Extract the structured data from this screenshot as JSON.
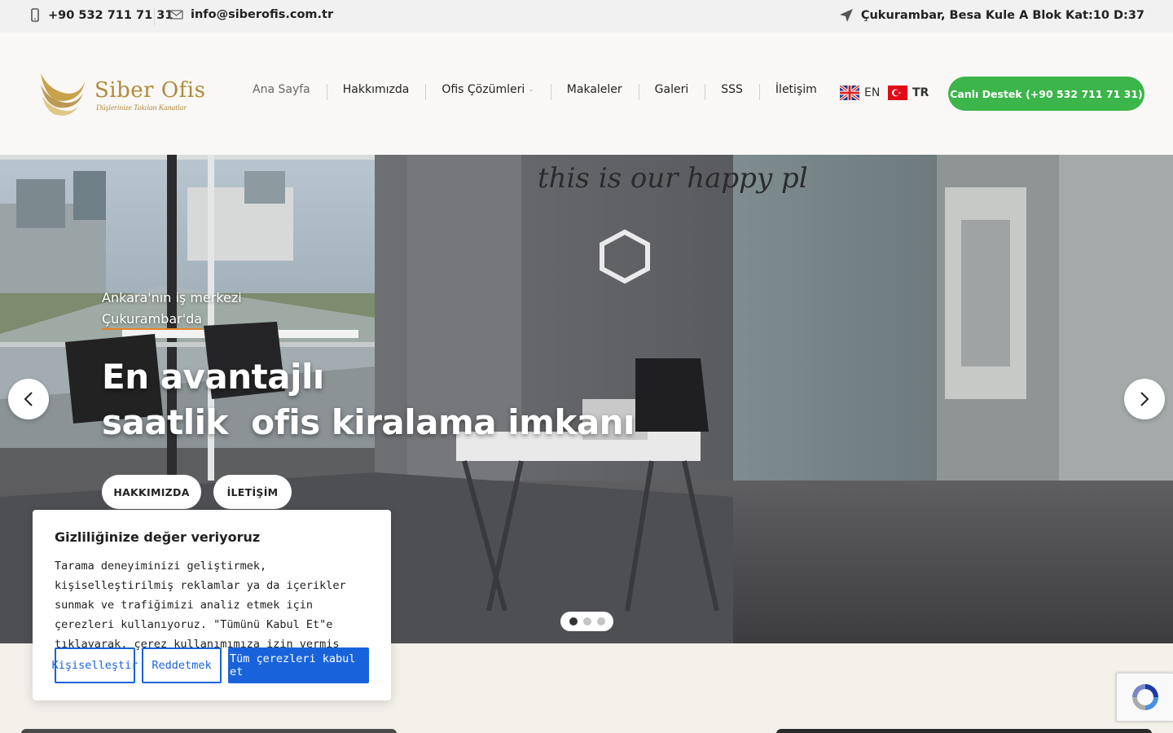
{
  "topbar": {
    "phone": "+90 532 711 71 31",
    "email": "info@siberofis.com.tr",
    "address": "Çukurambar, Besa Kule A Blok Kat:10 D:37"
  },
  "header": {
    "logo": {
      "title": "Siber Ofis",
      "tagline": "Düşlerinize Takılan Kanatlar"
    },
    "nav": [
      {
        "label": "Ana Sayfa"
      },
      {
        "label": "Hakkımızda"
      },
      {
        "label": "Ofis Çözümleri"
      },
      {
        "label": "Makaleler"
      },
      {
        "label": "Galeri"
      },
      {
        "label": "SSS"
      },
      {
        "label": "İletişim"
      }
    ],
    "languages": [
      {
        "code": "EN"
      },
      {
        "code": "TR"
      }
    ],
    "live_support": "Canlı Destek (+90 532 711 71 31)"
  },
  "hero": {
    "subtitle_line1": "Ankara'nın iş merkezi",
    "subtitle_line2": "Çukurambar'da",
    "title_line1": "En avantajlı",
    "title_line2": "saatlik  ofis kiralama imkanı",
    "button_about": "HAKKIMIZDA",
    "button_contact": "İLETİŞİM",
    "wall_text": "this is our happy pl",
    "slide_count": 3,
    "active_slide": 1
  },
  "cookie": {
    "title": "Gizliliğinize değer veriyoruz",
    "text": "Tarama deneyiminizi geliştirmek, kişiselleştirilmiş reklamlar ya da içerikler sunmak ve trafiğimizi analiz etmek için çerezleri kullanıyoruz. \"Tümünü Kabul Et\"e tıklayarak, çerez kullanımımıza izin vermiş olursunuz.",
    "customize": "Kişiselleştir",
    "reject": "Reddetmek",
    "accept_all": "Tüm çerezleri kabul et"
  },
  "colors": {
    "brand_gold": "#b08a3a",
    "live_support_green": "#3cb54a",
    "cookie_blue": "#1863dc",
    "accent_orange": "#e4842a"
  }
}
